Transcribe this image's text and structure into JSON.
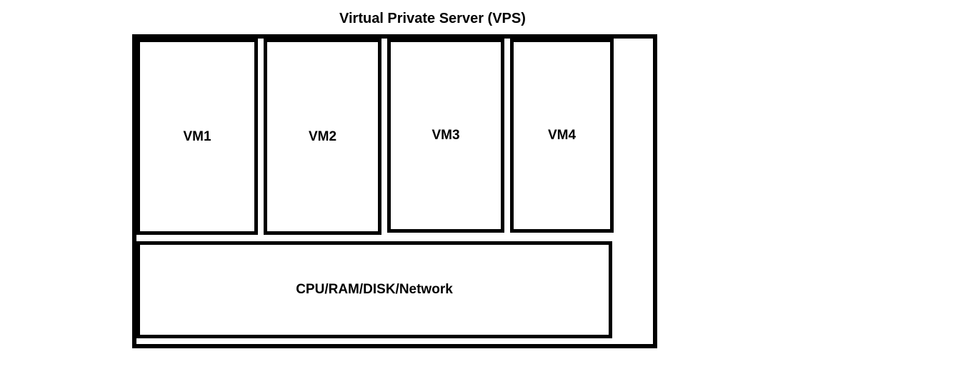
{
  "title": "Virtual Private Server (VPS)",
  "vms": {
    "vm1": "VM1",
    "vm2": "VM2",
    "vm3": "VM3",
    "vm4": "VM4"
  },
  "resources": "CPU/RAM/DISK/Network"
}
